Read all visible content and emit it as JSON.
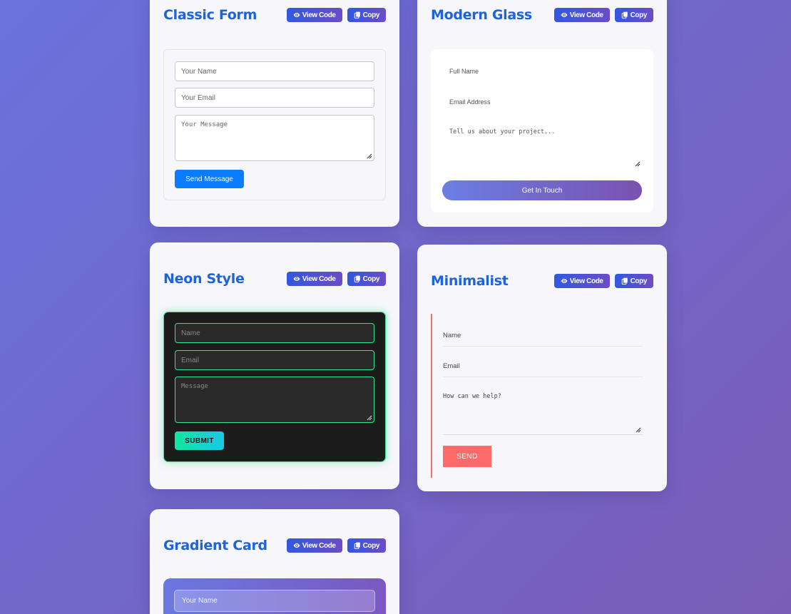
{
  "buttons": {
    "view_code": "View Code",
    "copy": "Copy"
  },
  "cards": {
    "classic": {
      "title": "Classic Form",
      "name_placeholder": "Your Name",
      "email_placeholder": "Your Email",
      "message_placeholder": "Your Message",
      "submit": "Send Message"
    },
    "glass": {
      "title": "Modern Glass",
      "name_placeholder": "Full Name",
      "email_placeholder": "Email Address",
      "message_placeholder": "Tell us about your project...",
      "submit": "Get In Touch"
    },
    "neon": {
      "title": "Neon Style",
      "name_placeholder": "Name",
      "email_placeholder": "Email",
      "message_placeholder": "Message",
      "submit": "SUBMIT"
    },
    "minimalist": {
      "title": "Minimalist",
      "name_placeholder": "Name",
      "email_placeholder": "Email",
      "message_placeholder": "How can we help?",
      "submit": "SEND"
    },
    "gradient": {
      "title": "Gradient Card",
      "name_placeholder": "Your Name"
    }
  },
  "colors": {
    "background_start": "#6a72dc",
    "background_end": "#7a5db8",
    "title": "#1d63dc",
    "classic_button": "#0a7cff",
    "neon_border": "#2ee88c",
    "minimalist_accent": "#ff6b6b"
  },
  "icons": {
    "view_code": "eye-icon",
    "copy": "copy-icon",
    "resize": "resize-grip-icon"
  }
}
